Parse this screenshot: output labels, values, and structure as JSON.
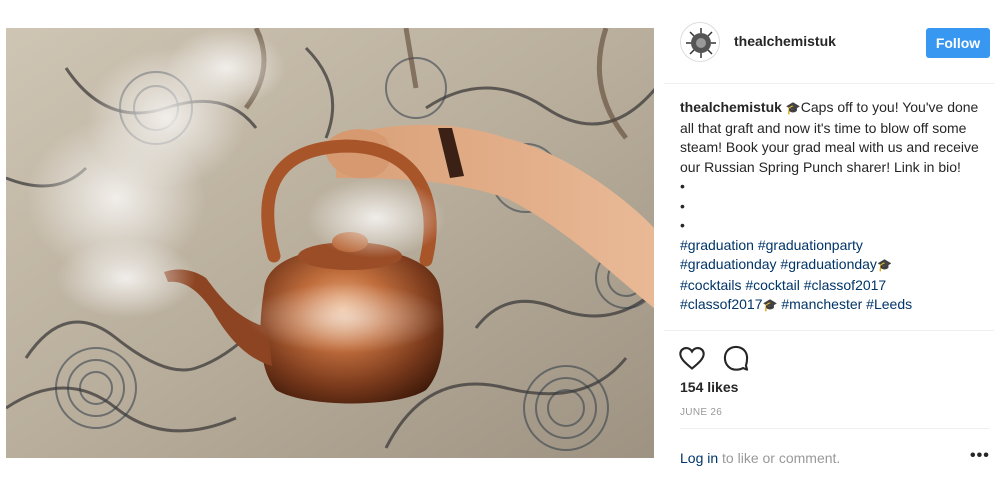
{
  "post": {
    "username": "thealchemistuk",
    "follow_label": "Follow",
    "caption": {
      "username": "thealchemistuk",
      "icon": "graduation-cap-icon",
      "text": "Caps off to you! You've done all that graft and now it's time to blow off some steam! Book your grad meal with us and receive our Russian Spring Punch sharer! Link in bio!",
      "bullets": [
        "•",
        "•",
        "•"
      ],
      "hashtags_line1": "#graduation #graduationparty",
      "hashtags_line2": "#graduationday #graduationday",
      "hashtags_line3": "#cocktails #cocktail #classof2017",
      "hashtags_line4a": "#classof2017",
      "hashtags_line4b": " #manchester #Leeds"
    },
    "likes": "154 likes",
    "date": "JUNE 26",
    "login_link": "Log in",
    "login_text": " to like or comment.",
    "more": "•••"
  },
  "colors": {
    "follow_bg": "#3897f0",
    "hashtag": "#003569",
    "muted": "#999999"
  }
}
